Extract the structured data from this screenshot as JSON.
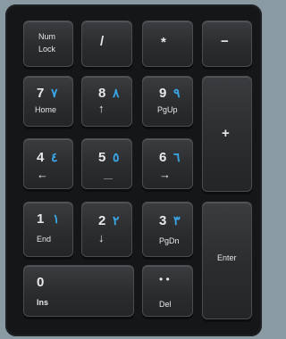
{
  "keys": {
    "numlock": {
      "line1": "Num",
      "line2": "Lock"
    },
    "slash": {
      "main": "/"
    },
    "star": {
      "main": "*"
    },
    "minus": {
      "main": "−"
    },
    "k7": {
      "main": "7",
      "arabic": "٧",
      "sub": "Home"
    },
    "k8": {
      "main": "8",
      "arabic": "٨",
      "sub": "↑"
    },
    "k9": {
      "main": "9",
      "arabic": "٩",
      "sub": "PgUp"
    },
    "plus": {
      "main": "+"
    },
    "k4": {
      "main": "4",
      "arabic": "٤",
      "sub": "←"
    },
    "k5": {
      "main": "5",
      "arabic": "٥"
    },
    "k6": {
      "main": "6",
      "arabic": "٦",
      "sub": "→"
    },
    "k1": {
      "main": "1",
      "arabic": "١",
      "sub": "End"
    },
    "k2": {
      "main": "2",
      "arabic": "٢",
      "sub": "↓"
    },
    "k3": {
      "main": "3",
      "arabic": "٣",
      "sub": "PgDn"
    },
    "enter": {
      "main": "Enter"
    },
    "k0": {
      "main": "0",
      "sub": "Ins"
    },
    "del": {
      "main": "• •",
      "sub": "Del"
    }
  },
  "colors": {
    "keycap": "#2e3033",
    "legend": "#e8e8e8",
    "arabic_legend": "#3aa6e6",
    "background": "#8a9aa2"
  }
}
